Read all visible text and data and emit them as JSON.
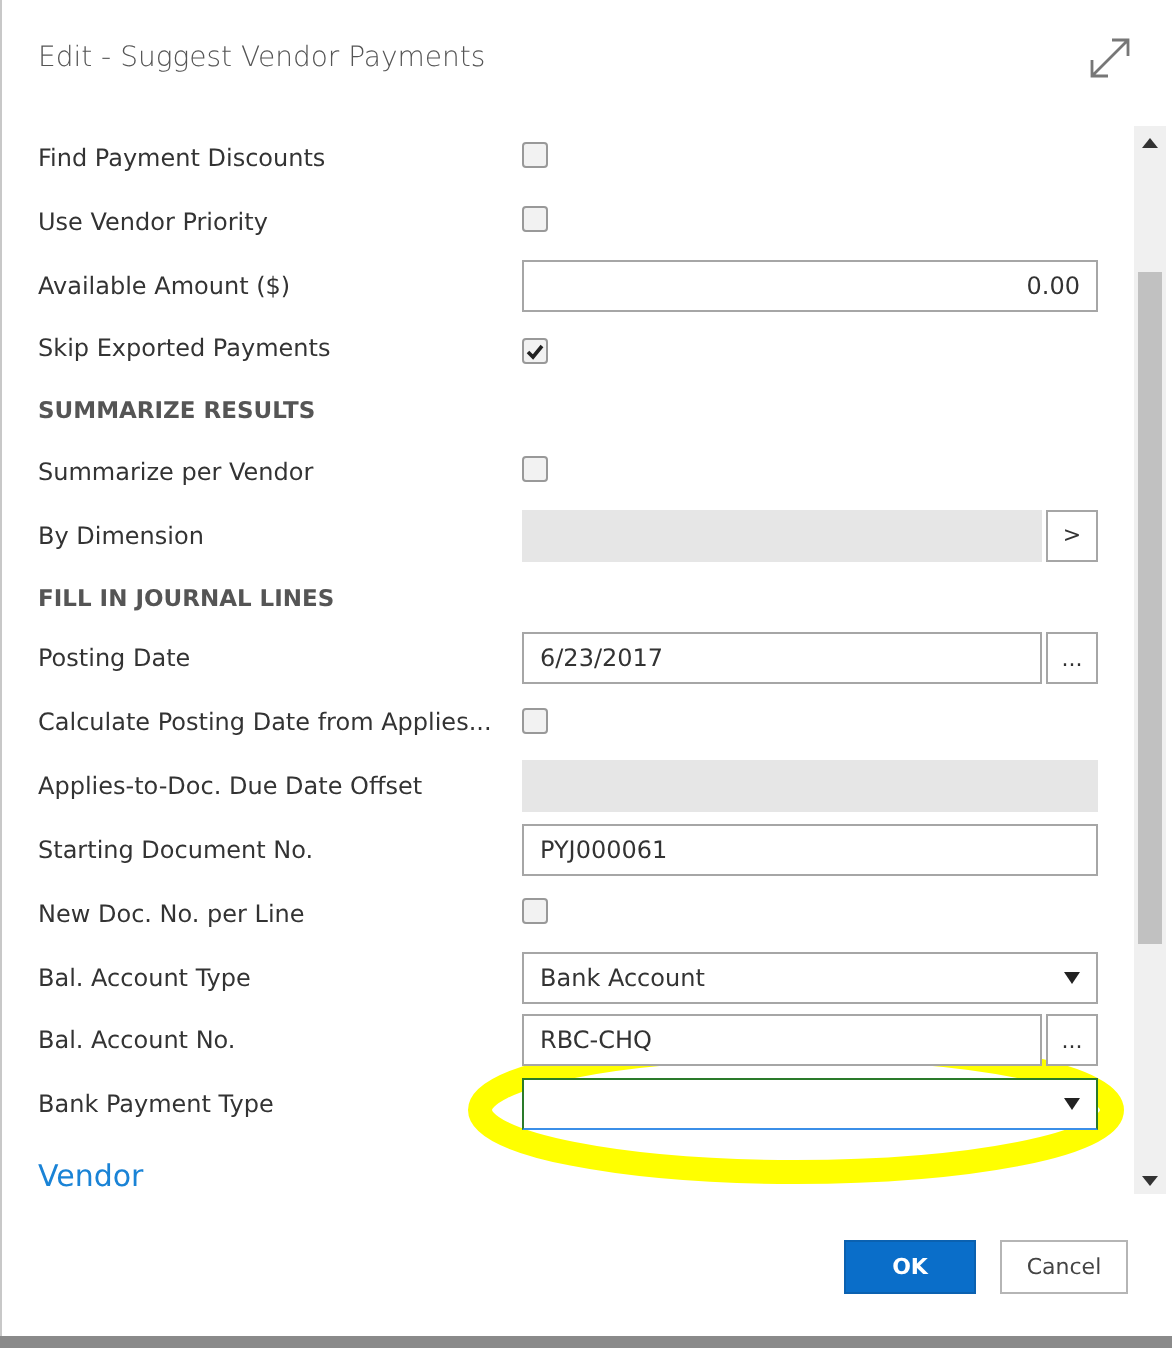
{
  "dialog": {
    "title": "Edit - Suggest Vendor Payments"
  },
  "fields": [
    {
      "kind": "checkbox",
      "label": "Find Payment Discounts",
      "checked": false
    },
    {
      "kind": "checkbox",
      "label": "Use Vendor Priority",
      "checked": false
    },
    {
      "kind": "number",
      "label": "Available Amount ($)",
      "value": "0.00"
    },
    {
      "kind": "checkbox",
      "label": "Skip Exported Payments",
      "checked": true
    },
    {
      "kind": "heading",
      "label": "SUMMARIZE RESULTS"
    },
    {
      "kind": "checkbox",
      "label": "Summarize per Vendor",
      "checked": false
    },
    {
      "kind": "disabled",
      "label": "By Dimension",
      "button": ">"
    },
    {
      "kind": "heading",
      "label": "FILL IN JOURNAL LINES"
    },
    {
      "kind": "text",
      "label": "Posting Date",
      "value": "6/23/2017",
      "button": "..."
    },
    {
      "kind": "checkbox",
      "label": "Calculate Posting Date from Applies...",
      "checked": false
    },
    {
      "kind": "disabled",
      "label": "Applies-to-Doc. Due Date Offset"
    },
    {
      "kind": "text",
      "label": "Starting Document No.",
      "value": "PYJ000061"
    },
    {
      "kind": "checkbox",
      "label": "New Doc. No. per Line",
      "checked": false
    },
    {
      "kind": "select",
      "label": "Bal. Account Type",
      "value": "Bank Account",
      "focused": false
    },
    {
      "kind": "text",
      "label": "Bal. Account No.",
      "value": "RBC-CHQ",
      "button": "..."
    },
    {
      "kind": "select",
      "label": "Bank Payment Type",
      "focused": true
    }
  ],
  "section_link": "Vendor",
  "buttons": [
    {
      "label": "OK",
      "primary": true
    },
    {
      "label": "Cancel",
      "primary": false
    }
  ]
}
